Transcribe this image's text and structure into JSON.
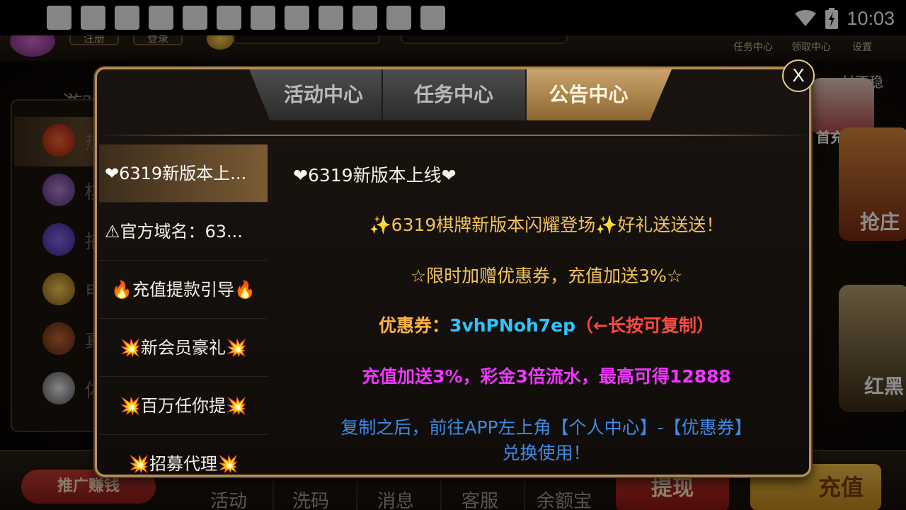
{
  "statusbar": {
    "time": "10:03",
    "notification_icon_count": 12
  },
  "lobby": {
    "top": {
      "register": "注册",
      "login": "登录",
      "task_center": "任务中心",
      "claim_center": "领取中心",
      "settings": "设置",
      "marquee": "付不稳",
      "first_recharge": "首充送"
    },
    "side": {
      "title": "游戏",
      "items": [
        "热",
        "棋",
        "捕",
        "电",
        "真",
        "体"
      ]
    },
    "right": {
      "banner1": "抢庄",
      "banner2": "红黑"
    },
    "bottom": {
      "promo": "推广赚钱",
      "items": [
        "活动",
        "洗码",
        "消息",
        "客服",
        "余额宝"
      ],
      "withdraw": "提现",
      "recharge": "充值"
    }
  },
  "modal": {
    "tabs": [
      {
        "label": "活动中心",
        "active": false
      },
      {
        "label": "任务中心",
        "active": false
      },
      {
        "label": "公告中心",
        "active": true
      }
    ],
    "close": "X",
    "list": [
      {
        "label": "❤6319新版本上...",
        "active": true
      },
      {
        "label": "⚠官方域名：63...",
        "active": false
      },
      {
        "label": "🔥充值提款引导🔥",
        "active": false
      },
      {
        "label": "💥新会员豪礼💥",
        "active": false
      },
      {
        "label": "💥百万任你提💥",
        "active": false
      },
      {
        "label": "💥招募代理💥",
        "active": false
      }
    ],
    "content": {
      "title": "❤6319新版本上线❤",
      "line1": "✨6319棋牌新版本闪耀登场✨好礼送送送！",
      "line2": "☆限时加赠优惠券，充值加送3%☆",
      "coupon_label": "优惠券：",
      "coupon_code": "3vhPNoh7ep",
      "coupon_hint": "（←长按可复制）",
      "line4": "充值加送3%，彩金3倍流水，最高可得12888",
      "line5": "复制之后，前往APP左上角【个人中心】-【优惠券】",
      "line6": "兑换使用！"
    }
  }
}
